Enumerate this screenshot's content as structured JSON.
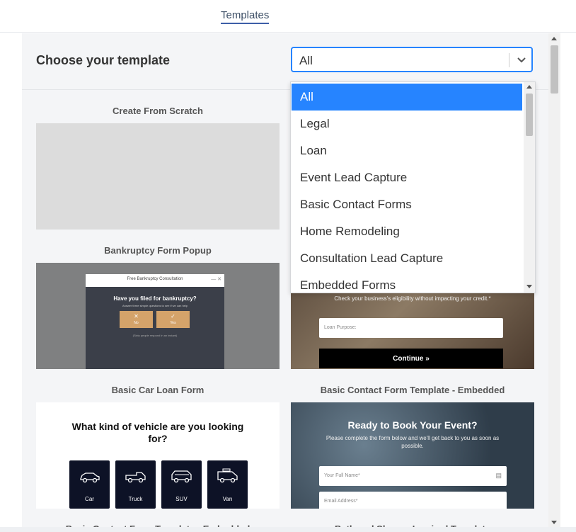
{
  "header": {
    "tab_label": "Templates"
  },
  "panel": {
    "title": "Choose your template",
    "select": {
      "value": "All"
    }
  },
  "dropdown": {
    "options": [
      "All",
      "Legal",
      "Loan",
      "Event Lead Capture",
      "Basic Contact Forms",
      "Home Remodeling",
      "Consultation Lead Capture",
      "Embedded Forms"
    ],
    "selected_index": 0
  },
  "cards": [
    {
      "title": "Create From Scratch"
    },
    {
      "title": "Bankruptcy Form Popup"
    },
    {
      "title": "Basic Car Loan Form"
    },
    {
      "title": "Basic Contact Form Template - Embedded"
    },
    {
      "title": "Basic Contact Form Template - Embedded"
    },
    {
      "title": "Bath and Shower Inspired Template"
    }
  ],
  "bankruptcy_preview": {
    "window_title": "Free Bankruptcy Consultation",
    "question": "Have you filed for bankruptcy?",
    "subtext": "Answer three simple questions to see if we can help",
    "btn_no": "No",
    "btn_yes": "Yes",
    "footer": "(Sixty people respond in an instant)",
    "close_glyph": "— ✕"
  },
  "loan_preview": {
    "tagline": "Check your business's eligibility without impacting your credit.*",
    "field_placeholder": "Loan Purpose:",
    "button": "Continue »"
  },
  "car_preview": {
    "question": "What kind of vehicle are you looking for?",
    "options": [
      "Car",
      "Truck",
      "SUV",
      "Van"
    ]
  },
  "event_preview": {
    "heading": "Ready to Book Your Event?",
    "subtext": "Please complete the form below and we'll get back to you as soon as possible.",
    "name_placeholder": "Your Full Name*",
    "email_placeholder": "Email Address*"
  }
}
